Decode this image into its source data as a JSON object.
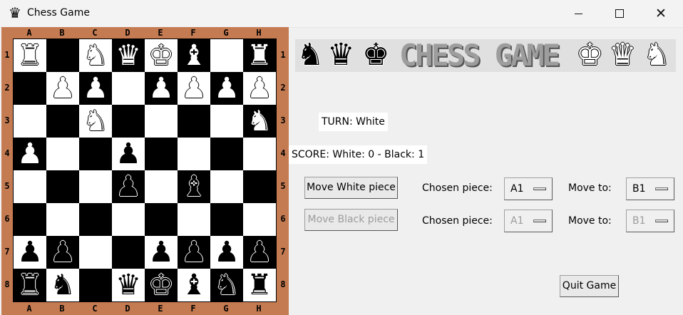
{
  "window": {
    "title": "Chess Game",
    "app_icon": "♛",
    "controls": {
      "minimize": "minimize-icon",
      "maximize": "maximize-icon",
      "close": "✕"
    }
  },
  "board": {
    "files": [
      "A",
      "B",
      "C",
      "D",
      "E",
      "F",
      "G",
      "H"
    ],
    "ranks": [
      "1",
      "2",
      "3",
      "4",
      "5",
      "6",
      "7",
      "8"
    ],
    "frame_color": "#c57b52",
    "rows": [
      [
        {
          "glyph": "♜",
          "color": "white"
        },
        {
          "glyph": "",
          "color": ""
        },
        {
          "glyph": "♞",
          "color": "white"
        },
        {
          "glyph": "♛",
          "color": "white"
        },
        {
          "glyph": "♚",
          "color": "white"
        },
        {
          "glyph": "♝",
          "color": "white"
        },
        {
          "glyph": "",
          "color": ""
        },
        {
          "glyph": "♜",
          "color": "white"
        }
      ],
      [
        {
          "glyph": "",
          "color": ""
        },
        {
          "glyph": "♟",
          "color": "white"
        },
        {
          "glyph": "♟",
          "color": "white"
        },
        {
          "glyph": "",
          "color": ""
        },
        {
          "glyph": "♟",
          "color": "white"
        },
        {
          "glyph": "♟",
          "color": "white"
        },
        {
          "glyph": "♟",
          "color": "white"
        },
        {
          "glyph": "♟",
          "color": "white"
        }
      ],
      [
        {
          "glyph": "",
          "color": ""
        },
        {
          "glyph": "",
          "color": ""
        },
        {
          "glyph": "♞",
          "color": "white"
        },
        {
          "glyph": "",
          "color": ""
        },
        {
          "glyph": "",
          "color": ""
        },
        {
          "glyph": "",
          "color": ""
        },
        {
          "glyph": "",
          "color": ""
        },
        {
          "glyph": "♞",
          "color": "white"
        }
      ],
      [
        {
          "glyph": "♟",
          "color": "white"
        },
        {
          "glyph": "",
          "color": ""
        },
        {
          "glyph": "",
          "color": ""
        },
        {
          "glyph": "♟",
          "color": "black"
        },
        {
          "glyph": "",
          "color": ""
        },
        {
          "glyph": "",
          "color": ""
        },
        {
          "glyph": "",
          "color": ""
        },
        {
          "glyph": "",
          "color": ""
        }
      ],
      [
        {
          "glyph": "",
          "color": ""
        },
        {
          "glyph": "",
          "color": ""
        },
        {
          "glyph": "",
          "color": ""
        },
        {
          "glyph": "♟",
          "color": "black"
        },
        {
          "glyph": "",
          "color": ""
        },
        {
          "glyph": "♝",
          "color": "black"
        },
        {
          "glyph": "",
          "color": ""
        },
        {
          "glyph": "",
          "color": ""
        }
      ],
      [
        {
          "glyph": "",
          "color": ""
        },
        {
          "glyph": "",
          "color": ""
        },
        {
          "glyph": "",
          "color": ""
        },
        {
          "glyph": "",
          "color": ""
        },
        {
          "glyph": "",
          "color": ""
        },
        {
          "glyph": "",
          "color": ""
        },
        {
          "glyph": "",
          "color": ""
        },
        {
          "glyph": "",
          "color": ""
        }
      ],
      [
        {
          "glyph": "♟",
          "color": "black"
        },
        {
          "glyph": "♟",
          "color": "black"
        },
        {
          "glyph": "",
          "color": ""
        },
        {
          "glyph": "",
          "color": ""
        },
        {
          "glyph": "♟",
          "color": "black"
        },
        {
          "glyph": "♟",
          "color": "black"
        },
        {
          "glyph": "♟",
          "color": "black"
        },
        {
          "glyph": "♟",
          "color": "black"
        }
      ],
      [
        {
          "glyph": "♜",
          "color": "black"
        },
        {
          "glyph": "♞",
          "color": "black"
        },
        {
          "glyph": "",
          "color": ""
        },
        {
          "glyph": "♛",
          "color": "black"
        },
        {
          "glyph": "♚",
          "color": "black"
        },
        {
          "glyph": "♝",
          "color": "black"
        },
        {
          "glyph": "♞",
          "color": "black"
        },
        {
          "glyph": "♜",
          "color": "black"
        }
      ]
    ]
  },
  "banner": {
    "text": "CHESS GAME",
    "left_glyphs": [
      "♞",
      "♛",
      "♚"
    ],
    "right_glyphs": [
      "♚",
      "♛",
      "♞"
    ],
    "background": "#e0e0e0"
  },
  "status": {
    "turn": "TURN: White",
    "score": "SCORE: White: 0 - Black: 1"
  },
  "controls": {
    "white": {
      "button": "Move White piece",
      "chosen_label": "Chosen piece:",
      "chosen_value": "A1",
      "move_label": "Move to:",
      "move_value": "B1",
      "enabled": true
    },
    "black": {
      "button": "Move Black piece",
      "chosen_label": "Chosen piece:",
      "chosen_value": "A1",
      "move_label": "Move to:",
      "move_value": "B1",
      "enabled": false
    },
    "quit": "Quit Game"
  }
}
